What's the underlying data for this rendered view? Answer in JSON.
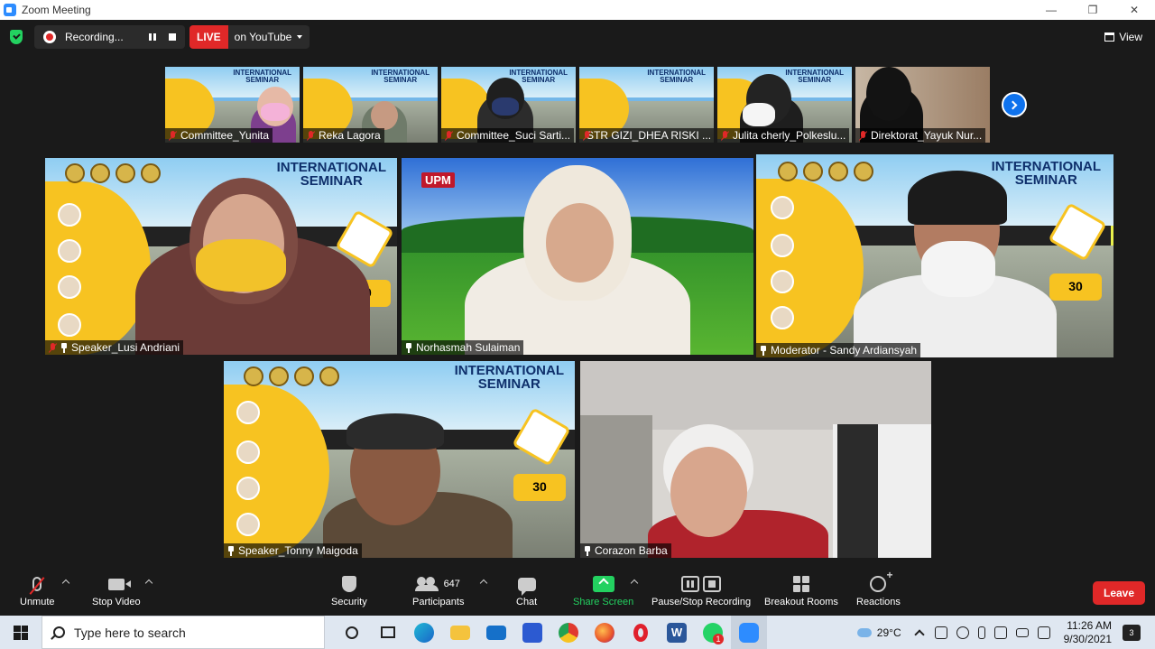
{
  "window": {
    "title": "Zoom Meeting"
  },
  "topbar": {
    "recording_label": "Recording...",
    "live_label": "LIVE",
    "live_destination": "on YouTube",
    "view_label": "View"
  },
  "thumbnails": [
    {
      "name": "Committee_Yunita"
    },
    {
      "name": "Reka Lagora"
    },
    {
      "name": "Committee_Suci Sarti..."
    },
    {
      "name": "STR GIZI_DHEA RISKI ..."
    },
    {
      "name": "Julita cherly_Polkeslu..."
    },
    {
      "name": "Direktorat_Yayuk Nur..."
    }
  ],
  "poster": {
    "title_line1": "INTERNATIONAL",
    "title_line2": "SEMINAR",
    "date_number": "30"
  },
  "tiles": [
    {
      "name": "Speaker_Lusi Andriani"
    },
    {
      "name": "Norhasmah Sulaiman",
      "logo_text": "UPM"
    },
    {
      "name": "Moderator - Sandy Ardiansyah"
    },
    {
      "name": "Speaker_Tonny Maigoda"
    },
    {
      "name": "Corazon Barba"
    }
  ],
  "toolbar": {
    "unmute": "Unmute",
    "stop_video": "Stop Video",
    "security": "Security",
    "participants": "Participants",
    "participants_count": "647",
    "chat": "Chat",
    "share_screen": "Share Screen",
    "pause_stop_recording": "Pause/Stop Recording",
    "breakout_rooms": "Breakout Rooms",
    "reactions": "Reactions",
    "leave": "Leave"
  },
  "taskbar": {
    "search_placeholder": "Type here to search",
    "weather": "29°C",
    "time": "11:26 AM",
    "date": "9/30/2021",
    "notification_count": "3",
    "whatsapp_badge": "1"
  },
  "colors": {
    "zoom_blue": "#2D8CFF",
    "live_red": "#E02828",
    "share_green": "#23D160",
    "active_speaker": "#E9F04C",
    "poster_yellow": "#F7C321"
  }
}
